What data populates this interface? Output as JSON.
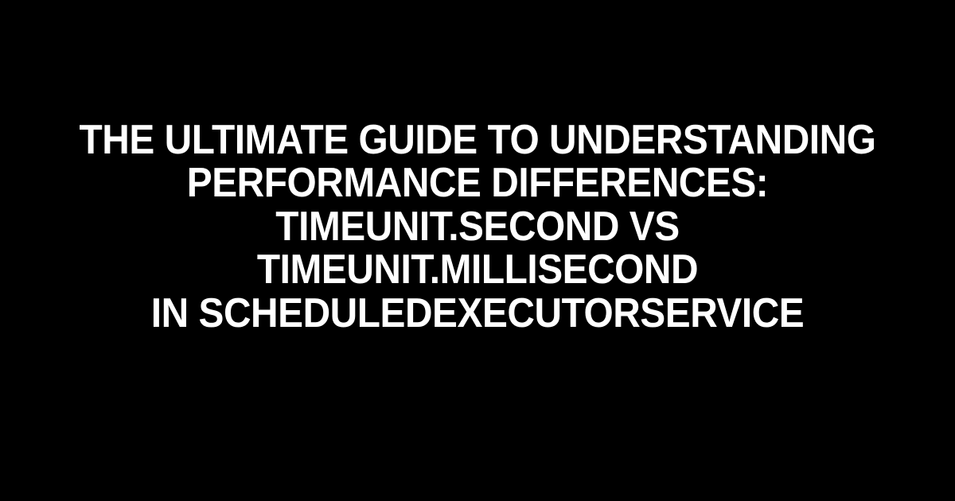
{
  "title_lines": [
    "THE ULTIMATE GUIDE TO UNDERSTANDING",
    "PERFORMANCE DIFFERENCES:",
    "TIMEUNIT.SECOND VS TIMEUNIT.MILLISECOND",
    "IN SCHEDULEDEXECUTORSERVICE"
  ],
  "title_full": "THE ULTIMATE GUIDE TO UNDERSTANDING PERFORMANCE DIFFERENCES: TIMEUNIT.SECOND VS TIMEUNIT.MILLISECOND IN SCHEDULEDEXECUTORSERVICE",
  "colors": {
    "background": "#000000",
    "text": "#ffffff"
  }
}
